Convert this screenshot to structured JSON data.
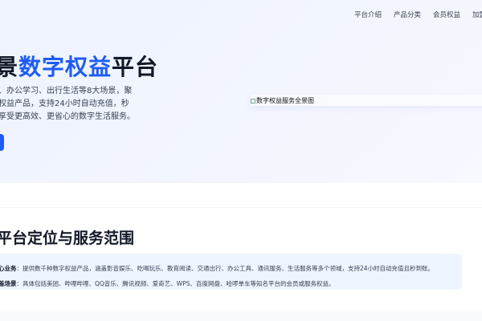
{
  "nav": {
    "items": [
      "平台介绍",
      "产品分类",
      "会员权益",
      "加盟"
    ]
  },
  "hero": {
    "title_prefix": "景",
    "title_highlight": "数字权益",
    "title_suffix": "平台",
    "description": [
      "、办公学习、出行生活等8大场景，聚",
      "权益产品，支持24小时自动充值，秒",
      "享受更高效、更省心的数字生活服务。"
    ],
    "image_alt": "数字权益服务全景图",
    "accent_color": "#1d5cf5"
  },
  "section": {
    "heading": "平台定位与服务范围",
    "rows": [
      {
        "label": "心业务",
        "text": "：提供数千种数字权益产品，涵盖影音娱乐、吃喝玩乐、教育阅读、交通出行、办公工具、通讯服务、生活服务等多个领域，支持24小时自动充值且秒到账。"
      },
      {
        "label": "盖场景",
        "text": "：具体包括美团、哔哩哔哩、QQ音乐、腾讯视频、爱奇艺、WPS、百度网盘、哈啰单车等知名平台的会员或服务权益。"
      }
    ]
  }
}
